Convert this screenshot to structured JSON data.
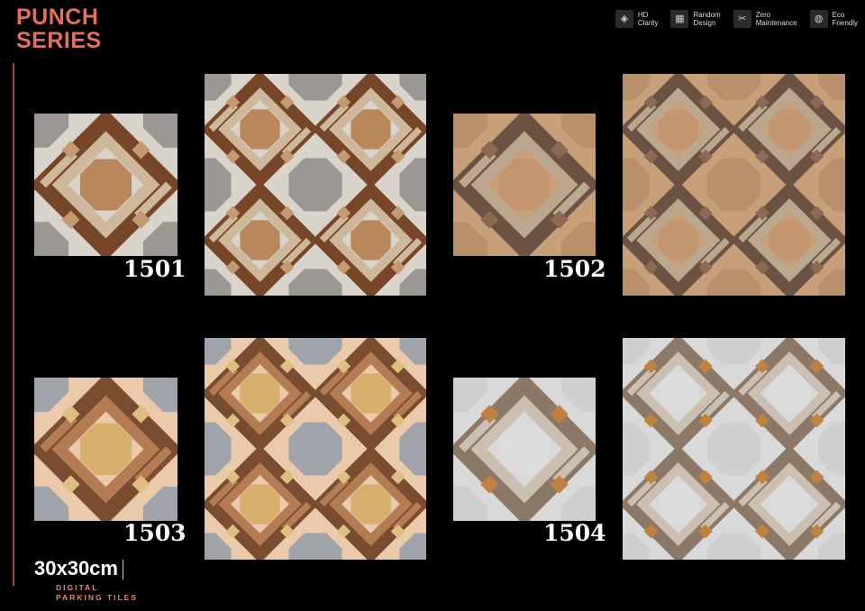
{
  "header": {
    "title_line1": "PUNCH",
    "title_line2": "SERIES"
  },
  "features": [
    {
      "icon": "hd-icon",
      "glyph": "◈",
      "label": "HD\nClarity"
    },
    {
      "icon": "grid-icon",
      "glyph": "▦",
      "label": "Random\nDesign"
    },
    {
      "icon": "tools-icon",
      "glyph": "✂",
      "label": "Zero\nMaintenance"
    },
    {
      "icon": "globe-icon",
      "glyph": "◍",
      "label": "Eco\nFriendly"
    }
  ],
  "tiles": [
    {
      "code": "1501",
      "colors": {
        "bg": "#d8d3cb",
        "corner": "#9b9893",
        "wood": "#774629",
        "wood2": "#cdb89c",
        "center": "#b9875c",
        "accent": "#c49a72"
      }
    },
    {
      "code": "1502",
      "colors": {
        "bg": "#c7a07a",
        "corner": "#b8916c",
        "wood": "#6b5242",
        "wood2": "#b9a790",
        "center": "#c39670",
        "accent": "#8a6a55"
      }
    },
    {
      "code": "1503",
      "colors": {
        "bg": "#ebc9ab",
        "corner": "#9fa4ab",
        "wood": "#7a4d31",
        "wood2": "#b47c52",
        "center": "#d7ae6c",
        "accent": "#e0bd80"
      }
    },
    {
      "code": "1504",
      "colors": {
        "bg": "#d9d9d9",
        "corner": "#cfcfcf",
        "wood": "#8c7866",
        "wood2": "#cbbfb1",
        "center": "#dcdcdc",
        "accent": "#c0823f"
      }
    }
  ],
  "footer": {
    "size": "30x30cm",
    "subtitle": "DIGITAL\nPARKING TILES"
  }
}
